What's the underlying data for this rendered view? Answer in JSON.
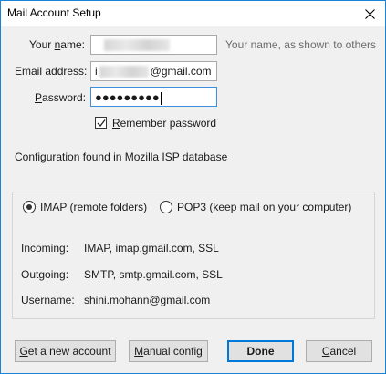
{
  "window": {
    "title": "Mail Account Setup",
    "accent": "#1883d7"
  },
  "form": {
    "name_label_prefix": "Your ",
    "name_label_mnemonic": "n",
    "name_label_suffix": "ame:",
    "name_hint": "Your name, as shown to others",
    "email_label": "Email address:",
    "email_value_prefix": "i",
    "email_value_suffix": "@gmail.com",
    "password_label_mnemonic": "P",
    "password_label_rest": "assword:",
    "password_value": "●●●●●●●●●",
    "remember_label_mnemonic": "R",
    "remember_label_rest": "emember password",
    "remember_checked": true
  },
  "status": "Configuration found in Mozilla ISP database",
  "config": {
    "imap_label": "IMAP (remote folders)",
    "pop3_label": "POP3 (keep mail on your computer)",
    "selected": "imap",
    "incoming_label": "Incoming:",
    "incoming_value": "IMAP, imap.gmail.com, SSL",
    "outgoing_label": "Outgoing:",
    "outgoing_value": "SMTP, smtp.gmail.com, SSL",
    "username_label": "Username:",
    "username_value": "shini.mohann@gmail.com"
  },
  "buttons": {
    "new_account_mnemonic": "G",
    "new_account_rest": "et a new account",
    "manual_mnemonic": "M",
    "manual_rest": "anual config",
    "done": "Done",
    "cancel_mnemonic": "C",
    "cancel_rest": "ancel"
  },
  "icons": {
    "close": "close-icon",
    "check": "checkmark-icon"
  }
}
